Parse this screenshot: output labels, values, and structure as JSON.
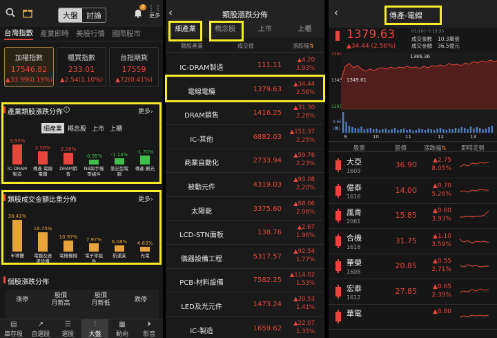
{
  "panel1": {
    "segment": [
      "大盤",
      "討論"
    ],
    "more": "更多",
    "badge": "2",
    "tabs": [
      "台灣指數",
      "產業即時",
      "美股行情",
      "國際股市"
    ],
    "indices": [
      {
        "name": "加權指數",
        "value": "17546.82",
        "change": "▲33.99(0.19%)"
      },
      {
        "name": "櫃買指數",
        "value": "233.01",
        "change": "▲2.54(1.10%)"
      },
      {
        "name": "台指期貨",
        "value": "17559",
        "change": "▲72(0.41%)"
      }
    ],
    "sector_title": "產業類股漲跌分佈",
    "sector_more": "更多",
    "sector_chips": [
      "細產業",
      "概念股",
      "上市",
      "上櫃"
    ],
    "sector_chart": {
      "type": "bar",
      "categories": [
        "IC-DRAM製造",
        "傳產-電線電纜",
        "DRAM銷售",
        "NB與手機零組件",
        "筆記型電腦",
        "傳產-觀光"
      ],
      "labels": [
        "3.93%",
        "2.56%",
        "2.26%",
        "-0.95%",
        "-1.14%",
        "-1.70%"
      ],
      "values": [
        3.93,
        2.56,
        2.26,
        -0.95,
        -1.14,
        -1.7
      ]
    },
    "volume_title": "類股成交金額比重分佈",
    "volume_more": "更多",
    "volume_chart": {
      "type": "bar",
      "categories": [
        "半導體",
        "電腦及週邊設備",
        "電機機械",
        "電子零組件",
        "航運業",
        "光電"
      ],
      "labels": [
        "30.41%",
        "18.75%",
        "10.97%",
        "7.97%",
        "6.08%",
        "4.63%"
      ],
      "values": [
        30.41,
        18.75,
        10.97,
        7.97,
        6.08,
        4.63
      ]
    },
    "stock_title": "個股漲跌分佈",
    "stock_items": [
      "漲停",
      "股價\n月新高",
      "股價\n月新低",
      "跌停"
    ],
    "nav": [
      "庫存股",
      "自選股",
      "選股",
      "大盤",
      "動向",
      "影音"
    ]
  },
  "panel2": {
    "title": "類股漲跌分佈",
    "tabs": [
      "細產業",
      "概念股",
      "上市",
      "上櫃"
    ],
    "cols": [
      "類股產業",
      "成交值",
      "漲跌幅"
    ],
    "rows": [
      {
        "name": "IC-DRAM製造",
        "vol": "111.11",
        "chg": "▲4.20",
        "pct": "3.93%"
      },
      {
        "name": "電線電纜",
        "vol": "1379.63",
        "chg": "▲34.44",
        "pct": "2.56%"
      },
      {
        "name": "DRAM銷售",
        "vol": "1416.25",
        "chg": "▲31.30",
        "pct": "2.26%"
      },
      {
        "name": "IC-其他",
        "vol": "6882.03",
        "chg": "▲151.37",
        "pct": "2.25%"
      },
      {
        "name": "商業自動化",
        "vol": "2733.94",
        "chg": "▲59.76",
        "pct": "2.23%"
      },
      {
        "name": "被動元件",
        "vol": "4319.03",
        "chg": "▲93.08",
        "pct": "2.20%"
      },
      {
        "name": "太陽能",
        "vol": "3375.60",
        "chg": "▲68.06",
        "pct": "2.06%"
      },
      {
        "name": "LCD-STN面板",
        "vol": "138.76",
        "chg": "▲2.67",
        "pct": "1.96%"
      },
      {
        "name": "儀器設備工程",
        "vol": "5317.57",
        "chg": "▲92.54",
        "pct": "1.77%"
      },
      {
        "name": "PCB-材料設備",
        "vol": "7582.25",
        "chg": "▲114.02",
        "pct": "1.53%"
      },
      {
        "name": "LED及光元件",
        "vol": "1473.24",
        "chg": "▲20.53",
        "pct": "1.41%"
      },
      {
        "name": "IC-製造",
        "vol": "1659.62",
        "chg": "▲22.07",
        "pct": "1.35%"
      }
    ]
  },
  "panel3": {
    "title": "傳產-電線",
    "price": "1379.63",
    "change": "▲34.44 (2.56%)",
    "date": "01/10(一) 13:35",
    "vol_label": "成交張數",
    "vol_value": "10.3萬張",
    "amt_label": "成交金額",
    "amt_value": "36.5億元",
    "chart_data": {
      "type": "line",
      "ylabels": [
        "1394",
        "1345",
        "1297"
      ],
      "high_label": "1386.36",
      "low_label": "1349.61",
      "volume_labels": [
        "0.66",
        "(萬)"
      ],
      "x": [
        "9",
        "10",
        "11",
        "12",
        "13"
      ]
    },
    "cols": [
      "股票",
      "股價",
      "漲跌幅",
      "即時走勢"
    ],
    "rows": [
      {
        "name": "大亞",
        "code": "1609",
        "price": "36.90",
        "chg": "▲2.75",
        "pct": "8.05%"
      },
      {
        "name": "億泰",
        "code": "1616",
        "price": "14.00",
        "chg": "▲0.70",
        "pct": "5.26%"
      },
      {
        "name": "風青",
        "code": "2061",
        "price": "15.85",
        "chg": "▲0.60",
        "pct": "3.93%"
      },
      {
        "name": "合機",
        "code": "1618",
        "price": "31.75",
        "chg": "▲1.10",
        "pct": "3.59%"
      },
      {
        "name": "華榮",
        "code": "1608",
        "price": "20.85",
        "chg": "▲0.55",
        "pct": "2.71%"
      },
      {
        "name": "宏泰",
        "code": "1612",
        "price": "27.85",
        "chg": "▲0.65",
        "pct": "2.39%"
      },
      {
        "name": "華電",
        "code": "",
        "price": "",
        "chg": "▲0.80",
        "pct": ""
      }
    ]
  }
}
